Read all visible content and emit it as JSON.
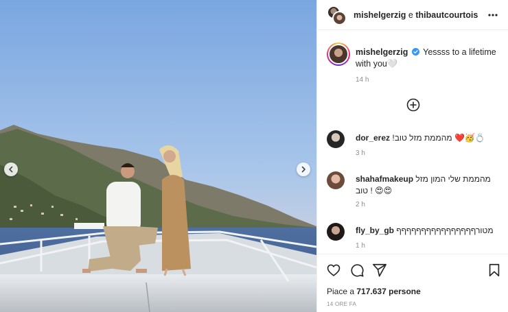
{
  "header": {
    "user1": "mishelgerzig",
    "conjunction": "e",
    "user2": "thibautcourtois"
  },
  "caption": {
    "username": "mishelgerzig",
    "text": "Yessss to a lifetime with you🤍",
    "time": "14 h"
  },
  "comments": [
    {
      "username": "dor_erez",
      "text": "!מהממת מזל טוב ❤️🥳💍",
      "time": "3 h"
    },
    {
      "username": "shahafmakeup",
      "text": "מהממת שלי המון מזל טוב ! 😍😍",
      "time": "2 h"
    },
    {
      "username": "fly_by_gb",
      "text": "מטורףףףףףףףףףףףףףףףף",
      "time": "1 h"
    }
  ],
  "likes": {
    "prefix": "Piace a",
    "count": "717.637",
    "suffix": "persone"
  },
  "post_date": "14 ORE FA",
  "icons": {
    "carousel_prev": "chevron-left-icon",
    "carousel_next": "chevron-right-icon",
    "more": "more-icon",
    "add_comment": "plus-circle-icon",
    "like": "heart-icon",
    "comment": "comment-icon",
    "share": "send-icon",
    "save": "bookmark-icon"
  },
  "colors": {
    "verified": "#3897f0",
    "text": "#262626",
    "muted": "#8e8e8e"
  }
}
